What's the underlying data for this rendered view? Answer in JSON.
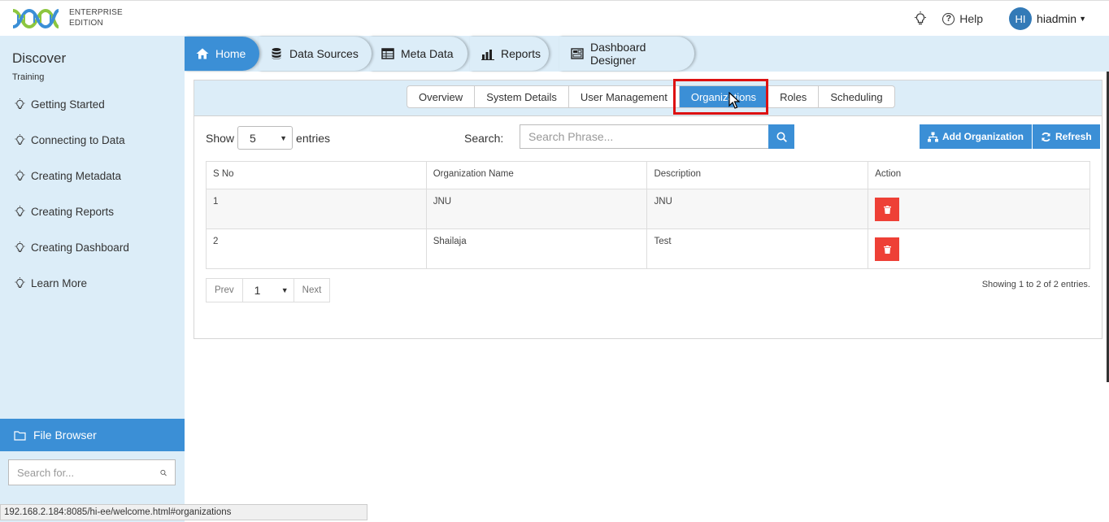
{
  "header": {
    "edition_line1": "ENTERPRISE",
    "edition_line2": "EDITION",
    "help_label": "Help",
    "user_initials": "HI",
    "username": "hiadmin"
  },
  "sidebar": {
    "title": "Discover",
    "subtitle": "Training",
    "items": [
      {
        "label": "Getting Started"
      },
      {
        "label": "Connecting to Data"
      },
      {
        "label": "Creating Metadata"
      },
      {
        "label": "Creating Reports"
      },
      {
        "label": "Creating Dashboard"
      },
      {
        "label": "Learn More"
      }
    ],
    "file_browser_label": "File Browser",
    "search_placeholder": "Search for..."
  },
  "nav": {
    "tabs": [
      {
        "label": "Home",
        "icon": "home-icon",
        "active": true
      },
      {
        "label": "Data Sources",
        "icon": "database-icon"
      },
      {
        "label": "Meta Data",
        "icon": "table-icon"
      },
      {
        "label": "Reports",
        "icon": "bar-chart-icon"
      },
      {
        "label": "Dashboard Designer",
        "icon": "dashboard-icon"
      }
    ]
  },
  "subtabs": [
    {
      "label": "Overview"
    },
    {
      "label": "System Details"
    },
    {
      "label": "User Management"
    },
    {
      "label": "Organizations",
      "active": true
    },
    {
      "label": "Roles"
    },
    {
      "label": "Scheduling"
    }
  ],
  "controls": {
    "show_label": "Show",
    "entries_value": "5",
    "entries_label": "entries",
    "search_label": "Search:",
    "search_placeholder": "Search Phrase...",
    "add_label": "Add Organization",
    "refresh_label": "Refresh"
  },
  "table": {
    "columns": [
      "S No",
      "Organization Name",
      "Description",
      "Action"
    ],
    "rows": [
      {
        "sno": "1",
        "name": "JNU",
        "description": "JNU"
      },
      {
        "sno": "2",
        "name": "Shailaja",
        "description": "Test"
      }
    ]
  },
  "pagination": {
    "prev": "Prev",
    "page": "1",
    "next": "Next",
    "showing": "Showing 1 to 2 of 2 entries."
  },
  "statusbar": {
    "url": "192.168.2.184:8085/hi-ee/welcome.html#organizations"
  },
  "colors": {
    "accent": "#3b8fd6",
    "sidebar_bg": "#dcedf8",
    "delete": "#ee4036",
    "highlight": "#dd1111"
  }
}
